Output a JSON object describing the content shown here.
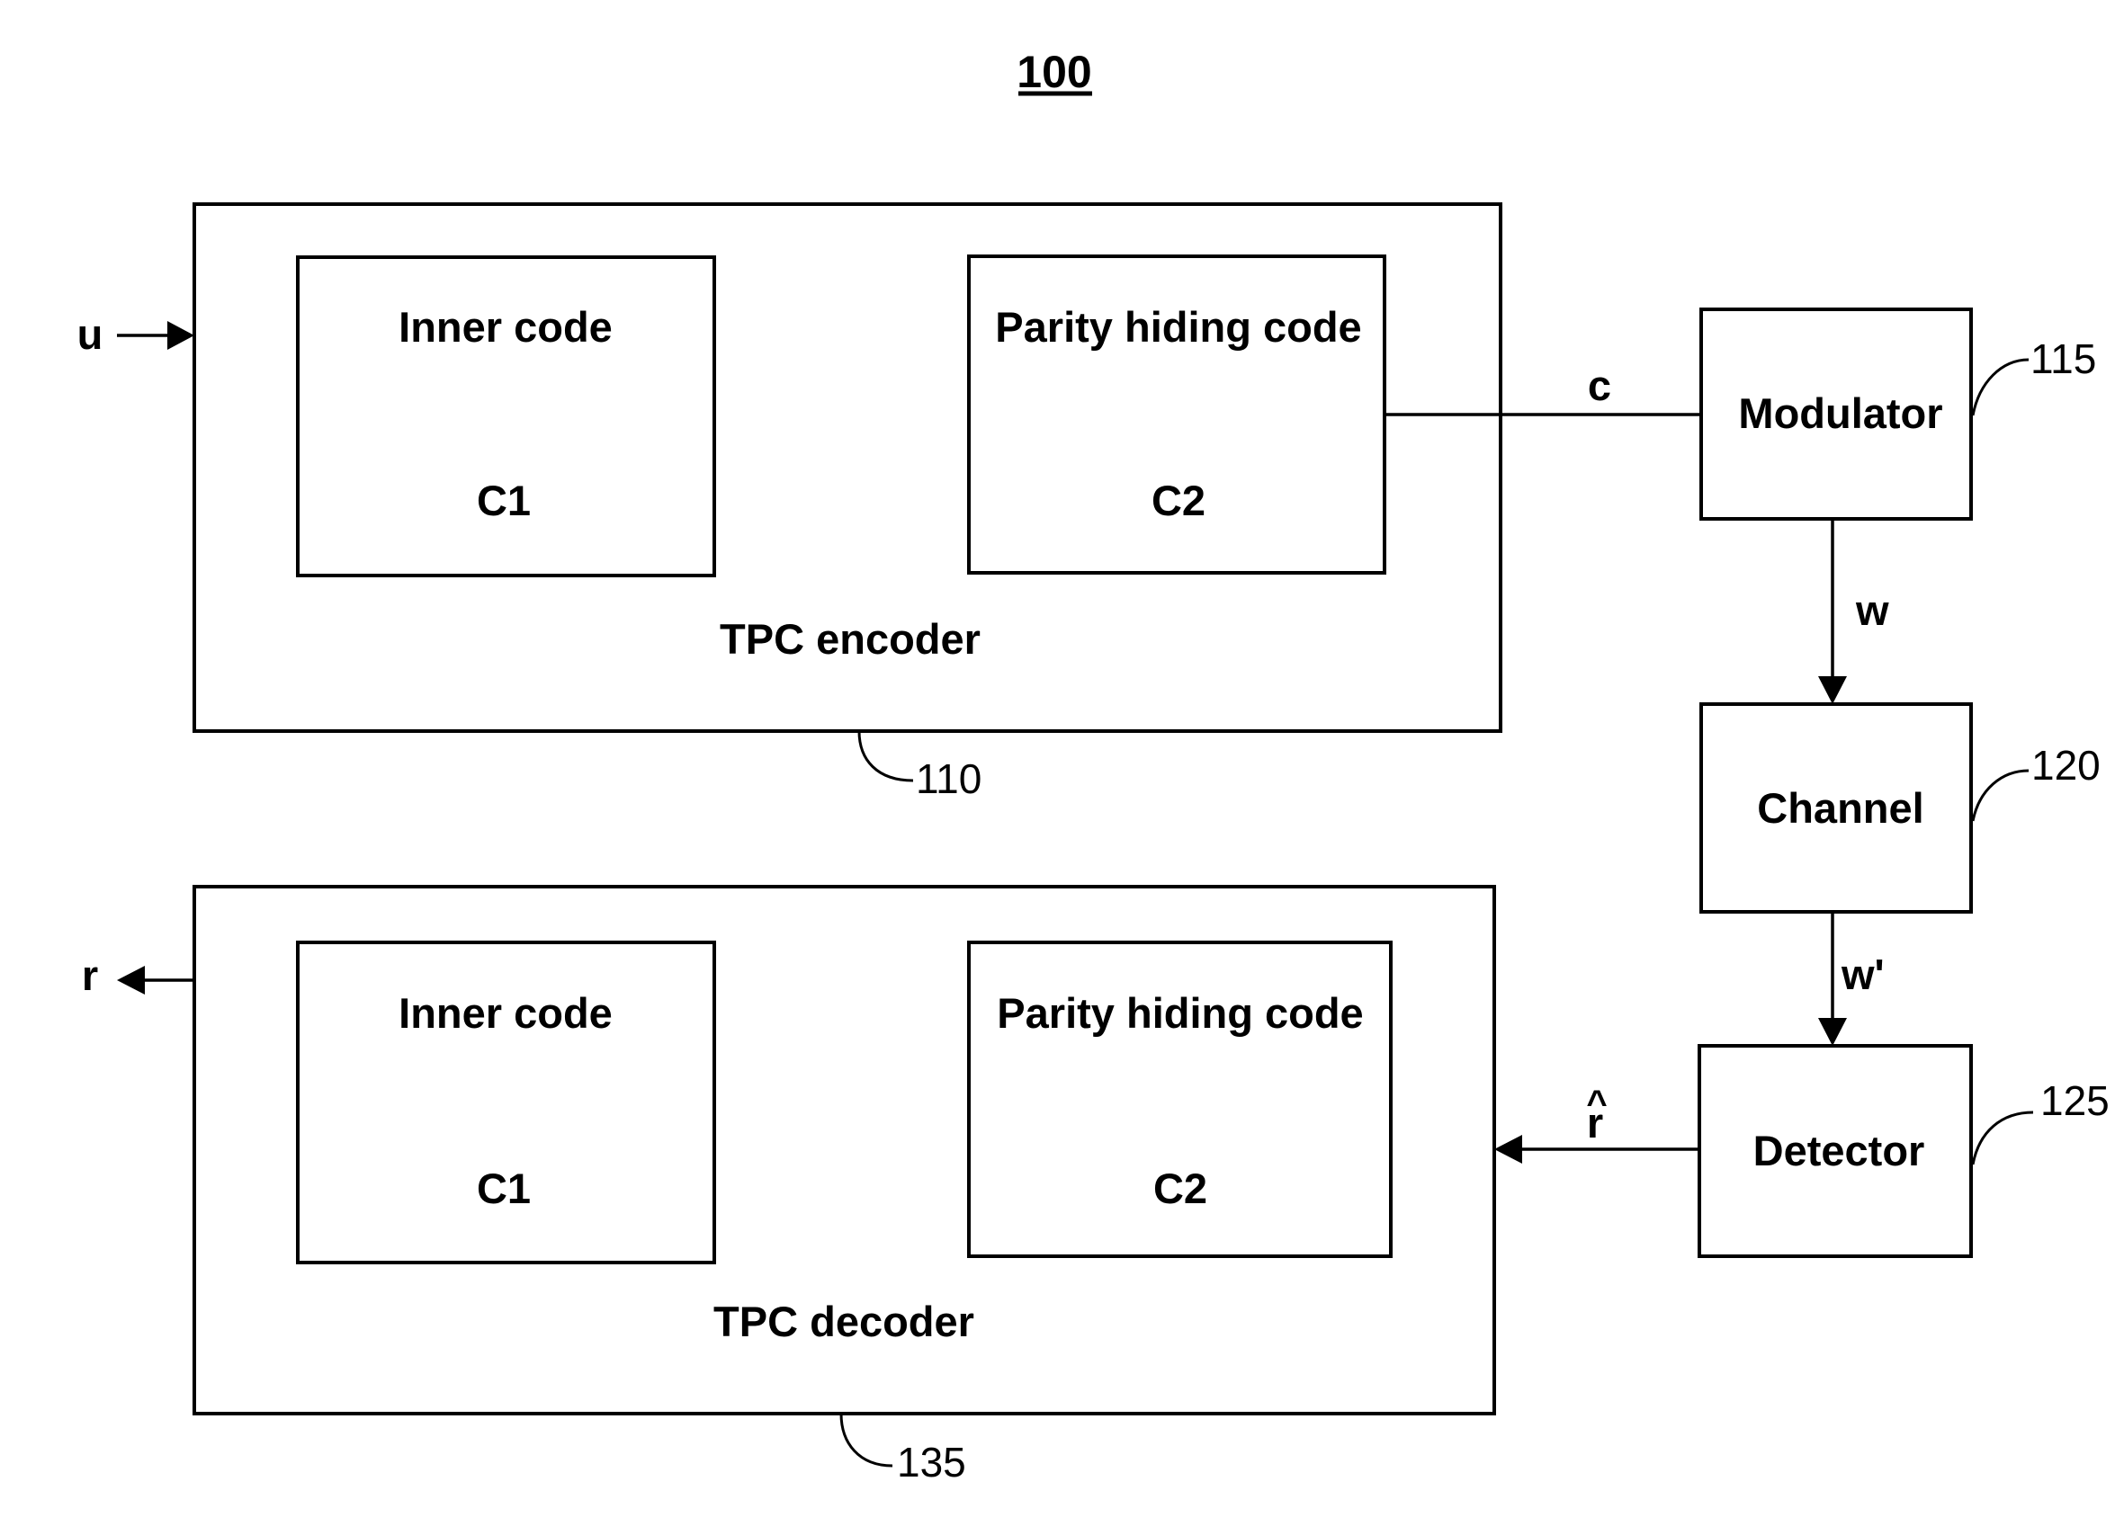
{
  "figure": {
    "number": "100"
  },
  "encoder": {
    "label": "TPC encoder",
    "ref": "110",
    "inner_code": {
      "title": "Inner code",
      "code": "C1"
    },
    "parity_code": {
      "title": "Parity hiding code",
      "code": "C2"
    }
  },
  "decoder": {
    "label": "TPC decoder",
    "ref": "135",
    "inner_code": {
      "title": "Inner code",
      "code": "C1"
    },
    "parity_code": {
      "title": "Parity hiding code",
      "code": "C2"
    }
  },
  "modulator": {
    "label": "Modulator",
    "ref": "115"
  },
  "channel": {
    "label": "Channel",
    "ref": "120"
  },
  "detector": {
    "label": "Detector",
    "ref": "125"
  },
  "signals": {
    "input": "u",
    "codeword": "c",
    "modulated": "w",
    "received": "w'",
    "detected_base": "r",
    "detected_hat": "^",
    "output": "r"
  }
}
